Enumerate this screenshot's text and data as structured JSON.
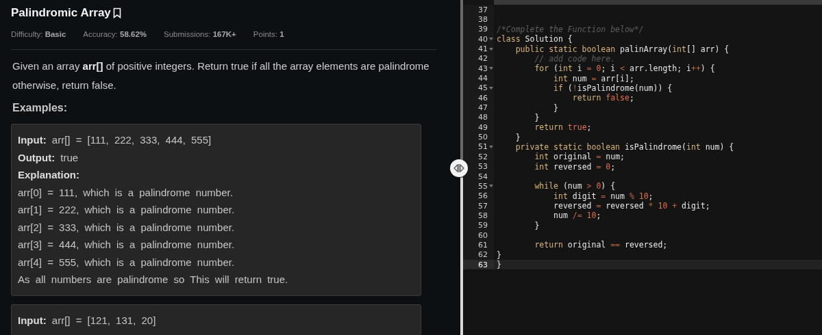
{
  "problem": {
    "title": "Palindromic Array",
    "meta": [
      "Difficulty: **Basic**",
      "Accuracy: **58.62%**",
      "Submissions: **167K+**",
      "Points: **1**"
    ],
    "description": "Given an array **arr[]** of positive integers. Return true if all the array elements are palindrome otherwise, return false.",
    "examples_heading": "Examples:",
    "examples": [
      {
        "lines": [
          "**Input:** arr[] = [111, 222, 333, 444, 555]",
          "**Output:** true",
          "**Explanation:**",
          "arr[0] = 111, which is a palindrome number.",
          "arr[1] = 222, which is a palindrome number.",
          "arr[2] = 333, which is a palindrome number.",
          "arr[3] = 444, which is a palindrome number.",
          "arr[4] = 555, which is a palindrome number.",
          "As all numbers are palindrome so This will return true."
        ]
      },
      {
        "lines": [
          "**Input:** arr[] = [121, 131, 20]"
        ]
      }
    ]
  },
  "editor": {
    "lines": [
      {
        "number": "37",
        "fold": false,
        "current": false
      },
      {
        "number": "38",
        "fold": false,
        "current": false
      },
      {
        "number": "39",
        "fold": false,
        "current": false,
        "tokens": [
          {
            "text": "/*Complete the Function below*/",
            "kind": "cm"
          }
        ]
      },
      {
        "number": "40",
        "fold": true,
        "current": false,
        "tokens": [
          {
            "text": "class",
            "kind": "kw"
          },
          {
            "text": " Solution {",
            "kind": "tx"
          }
        ]
      },
      {
        "number": "41",
        "fold": true,
        "current": false,
        "tokens": [
          {
            "text": "    public static boolean",
            "kind": "kw"
          },
          {
            "text": " palinArray(",
            "kind": "tx"
          },
          {
            "text": "int",
            "kind": "kw"
          },
          {
            "text": "[] arr) {",
            "kind": "tx"
          }
        ]
      },
      {
        "number": "42",
        "fold": false,
        "current": false,
        "tokens": [
          {
            "text": "        // add code here.",
            "kind": "cm"
          }
        ]
      },
      {
        "number": "43",
        "fold": true,
        "current": false,
        "tokens": [
          {
            "text": "        for",
            "kind": "kw"
          },
          {
            "text": " (",
            "kind": "tx"
          },
          {
            "text": "int",
            "kind": "kw"
          },
          {
            "text": " i ",
            "kind": "tx"
          },
          {
            "text": "= ",
            "kind": "op"
          },
          {
            "text": "0",
            "kind": "num"
          },
          {
            "text": "; i ",
            "kind": "tx"
          },
          {
            "text": "<",
            "kind": "op"
          },
          {
            "text": " arr.length; i",
            "kind": "tx"
          },
          {
            "text": "++",
            "kind": "op"
          },
          {
            "text": ") {",
            "kind": "tx"
          }
        ]
      },
      {
        "number": "44",
        "fold": false,
        "current": false,
        "tokens": [
          {
            "text": "            int",
            "kind": "kw"
          },
          {
            "text": " num ",
            "kind": "tx"
          },
          {
            "text": "=",
            "kind": "op"
          },
          {
            "text": " arr[i];",
            "kind": "tx"
          }
        ]
      },
      {
        "number": "45",
        "fold": true,
        "current": false,
        "tokens": [
          {
            "text": "            if",
            "kind": "kw"
          },
          {
            "text": " (",
            "kind": "tx"
          },
          {
            "text": "!",
            "kind": "op"
          },
          {
            "text": "isPalindrome(num)) {",
            "kind": "tx"
          }
        ]
      },
      {
        "number": "46",
        "fold": false,
        "current": false,
        "tokens": [
          {
            "text": "                return ",
            "kind": "kw"
          },
          {
            "text": "false",
            "kind": "num"
          },
          {
            "text": ";",
            "kind": "tx"
          }
        ]
      },
      {
        "number": "47",
        "fold": false,
        "current": false,
        "tokens": [
          {
            "text": "            }",
            "kind": "tx"
          }
        ]
      },
      {
        "number": "48",
        "fold": false,
        "current": false,
        "tokens": [
          {
            "text": "        }",
            "kind": "tx"
          }
        ]
      },
      {
        "number": "49",
        "fold": false,
        "current": false,
        "tokens": [
          {
            "text": "        return ",
            "kind": "kw"
          },
          {
            "text": "true",
            "kind": "num"
          },
          {
            "text": ";",
            "kind": "tx"
          }
        ]
      },
      {
        "number": "50",
        "fold": false,
        "current": false,
        "tokens": [
          {
            "text": "    }",
            "kind": "tx"
          }
        ]
      },
      {
        "number": "51",
        "fold": true,
        "current": false,
        "tokens": [
          {
            "text": "    private static boolean",
            "kind": "kw"
          },
          {
            "text": " isPalindrome(",
            "kind": "tx"
          },
          {
            "text": "int",
            "kind": "kw"
          },
          {
            "text": " num) {",
            "kind": "tx"
          }
        ]
      },
      {
        "number": "52",
        "fold": false,
        "current": false,
        "tokens": [
          {
            "text": "        int",
            "kind": "kw"
          },
          {
            "text": " original ",
            "kind": "tx"
          },
          {
            "text": "=",
            "kind": "op"
          },
          {
            "text": " num;",
            "kind": "tx"
          }
        ]
      },
      {
        "number": "53",
        "fold": false,
        "current": false,
        "tokens": [
          {
            "text": "        int",
            "kind": "kw"
          },
          {
            "text": " reversed ",
            "kind": "tx"
          },
          {
            "text": "= ",
            "kind": "op"
          },
          {
            "text": "0",
            "kind": "num"
          },
          {
            "text": ";",
            "kind": "tx"
          }
        ]
      },
      {
        "number": "54",
        "fold": false,
        "current": false
      },
      {
        "number": "55",
        "fold": true,
        "current": false,
        "tokens": [
          {
            "text": "        while",
            "kind": "kw"
          },
          {
            "text": " (num ",
            "kind": "tx"
          },
          {
            "text": "> ",
            "kind": "op"
          },
          {
            "text": "0",
            "kind": "num"
          },
          {
            "text": ") {",
            "kind": "tx"
          }
        ]
      },
      {
        "number": "56",
        "fold": false,
        "current": false,
        "tokens": [
          {
            "text": "            int",
            "kind": "kw"
          },
          {
            "text": " digit ",
            "kind": "tx"
          },
          {
            "text": "=",
            "kind": "op"
          },
          {
            "text": " num ",
            "kind": "tx"
          },
          {
            "text": "% ",
            "kind": "op"
          },
          {
            "text": "10",
            "kind": "num"
          },
          {
            "text": ";",
            "kind": "tx"
          }
        ]
      },
      {
        "number": "57",
        "fold": false,
        "current": false,
        "tokens": [
          {
            "text": "            reversed ",
            "kind": "tx"
          },
          {
            "text": "=",
            "kind": "op"
          },
          {
            "text": " reversed ",
            "kind": "tx"
          },
          {
            "text": "* ",
            "kind": "op"
          },
          {
            "text": "10",
            "kind": "num"
          },
          {
            "text": " +",
            "kind": "op"
          },
          {
            "text": " digit;",
            "kind": "tx"
          }
        ]
      },
      {
        "number": "58",
        "fold": false,
        "current": false,
        "tokens": [
          {
            "text": "            num ",
            "kind": "tx"
          },
          {
            "text": "/= ",
            "kind": "op"
          },
          {
            "text": "10",
            "kind": "num"
          },
          {
            "text": ";",
            "kind": "tx"
          }
        ]
      },
      {
        "number": "59",
        "fold": false,
        "current": false,
        "tokens": [
          {
            "text": "        }",
            "kind": "tx"
          }
        ]
      },
      {
        "number": "60",
        "fold": false,
        "current": false
      },
      {
        "number": "61",
        "fold": false,
        "current": false,
        "tokens": [
          {
            "text": "        return",
            "kind": "kw"
          },
          {
            "text": " original ",
            "kind": "tx"
          },
          {
            "text": "==",
            "kind": "op"
          },
          {
            "text": " reversed;",
            "kind": "tx"
          }
        ]
      },
      {
        "number": "62",
        "fold": false,
        "current": false,
        "tokens": [
          {
            "text": "}",
            "kind": "tx"
          }
        ]
      },
      {
        "number": "63",
        "fold": false,
        "current": true,
        "tokens": [
          {
            "text": "}",
            "kind": "tx"
          }
        ]
      }
    ]
  }
}
